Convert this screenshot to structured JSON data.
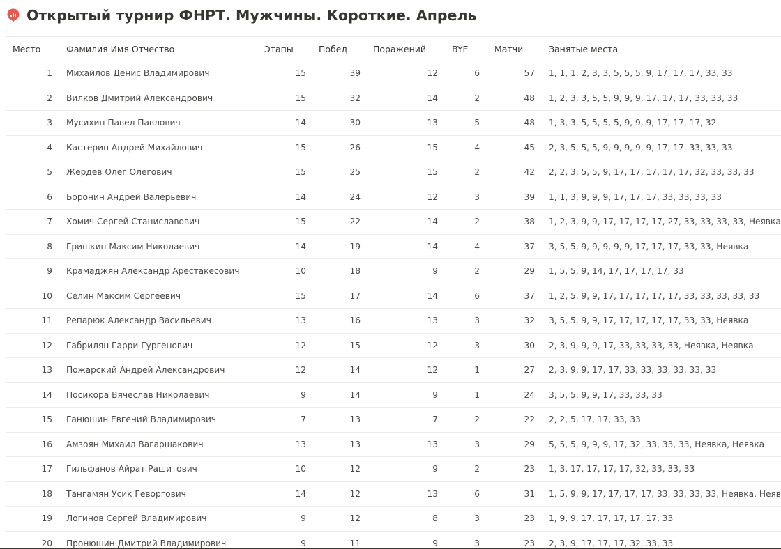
{
  "page": {
    "title": "Открытый турнир ФНРТ. Мужчины. Короткие. Апрель",
    "icon": "chart-pin-icon",
    "accent_color": "#e8584f"
  },
  "table": {
    "headers": {
      "place": "Место",
      "name": "Фамилия Имя Отчество",
      "stages": "Этапы",
      "wins": "Побед",
      "losses": "Поражений",
      "bye": "BYE",
      "matches": "Матчи",
      "places": "Занятые места"
    },
    "rows": [
      {
        "place": "1",
        "name": "Михайлов Денис Владимирович",
        "stages": "15",
        "wins": "39",
        "losses": "12",
        "bye": "6",
        "matches": "57",
        "places": "1, 1, 1, 2, 3, 3, 5, 5, 5, 9, 17, 17, 17, 33, 33"
      },
      {
        "place": "2",
        "name": "Вилков Дмитрий Александрович",
        "stages": "15",
        "wins": "32",
        "losses": "14",
        "bye": "2",
        "matches": "48",
        "places": "1, 2, 3, 3, 5, 5, 9, 9, 9, 17, 17, 17, 33, 33, 33"
      },
      {
        "place": "3",
        "name": "Мусихин Павел Павлович",
        "stages": "14",
        "wins": "30",
        "losses": "13",
        "bye": "5",
        "matches": "48",
        "places": "1, 3, 3, 5, 5, 5, 5, 9, 9, 9, 17, 17, 17, 32"
      },
      {
        "place": "4",
        "name": "Кастерин Андрей Михайлович",
        "stages": "15",
        "wins": "26",
        "losses": "15",
        "bye": "4",
        "matches": "45",
        "places": "2, 3, 5, 5, 5, 9, 9, 9, 9, 9, 17, 17, 33, 33, 33"
      },
      {
        "place": "5",
        "name": "Жердев Олег Олегович",
        "stages": "15",
        "wins": "25",
        "losses": "15",
        "bye": "2",
        "matches": "42",
        "places": "2, 2, 3, 5, 5, 9, 17, 17, 17, 17, 17, 32, 33, 33, 33"
      },
      {
        "place": "6",
        "name": "Боронин Андрей Валерьевич",
        "stages": "14",
        "wins": "24",
        "losses": "12",
        "bye": "3",
        "matches": "39",
        "places": "1, 1, 3, 9, 9, 9, 17, 17, 17, 33, 33, 33, 33"
      },
      {
        "place": "7",
        "name": "Хомич Сергей Станиславович",
        "stages": "15",
        "wins": "22",
        "losses": "14",
        "bye": "2",
        "matches": "38",
        "places": "1, 2, 3, 9, 9, 17, 17, 17, 17, 27, 33, 33, 33, 33, Неявка"
      },
      {
        "place": "8",
        "name": "Гришкин Максим Николаевич",
        "stages": "14",
        "wins": "19",
        "losses": "14",
        "bye": "4",
        "matches": "37",
        "places": "3, 5, 5, 9, 9, 9, 9, 9, 17, 17, 17, 33, 33, Неявка"
      },
      {
        "place": "9",
        "name": "Крамаджян Александр Арестакесович",
        "stages": "10",
        "wins": "18",
        "losses": "9",
        "bye": "2",
        "matches": "29",
        "places": "1, 5, 5, 9, 14, 17, 17, 17, 17, 33"
      },
      {
        "place": "10",
        "name": "Селин Максим Сергеевич",
        "stages": "15",
        "wins": "17",
        "losses": "14",
        "bye": "6",
        "matches": "37",
        "places": "1, 2, 5, 9, 9, 17, 17, 17, 17, 17, 33, 33, 33, 33, 33"
      },
      {
        "place": "11",
        "name": "Репарюк Александр Васильевич",
        "stages": "13",
        "wins": "16",
        "losses": "13",
        "bye": "3",
        "matches": "32",
        "places": "3, 5, 5, 9, 9, 17, 17, 17, 17, 17, 33, 33, Неявка"
      },
      {
        "place": "12",
        "name": "Габрилян Гарри Гургенович",
        "stages": "12",
        "wins": "15",
        "losses": "12",
        "bye": "3",
        "matches": "30",
        "places": "2, 3, 9, 9, 9, 17, 33, 33, 33, 33, Неявка, Неявка"
      },
      {
        "place": "13",
        "name": "Пожарский Андрей Александрович",
        "stages": "12",
        "wins": "14",
        "losses": "12",
        "bye": "1",
        "matches": "27",
        "places": "2, 3, 9, 9, 17, 17, 33, 33, 33, 33, 33, 33"
      },
      {
        "place": "14",
        "name": "Посикора Вячеслав Николаевич",
        "stages": "9",
        "wins": "14",
        "losses": "9",
        "bye": "1",
        "matches": "24",
        "places": "3, 5, 5, 9, 9, 17, 33, 33, 33"
      },
      {
        "place": "15",
        "name": "Ганюшин Евгений Владимирович",
        "stages": "7",
        "wins": "13",
        "losses": "7",
        "bye": "2",
        "matches": "22",
        "places": "2, 2, 5, 17, 17, 33, 33"
      },
      {
        "place": "16",
        "name": "Амзоян Михаил Вагаршакович",
        "stages": "13",
        "wins": "13",
        "losses": "13",
        "bye": "3",
        "matches": "29",
        "places": "5, 5, 5, 9, 9, 9, 17, 32, 33, 33, 33, Неявка, Неявка"
      },
      {
        "place": "17",
        "name": "Гильфанов Айрат Рашитович",
        "stages": "10",
        "wins": "12",
        "losses": "9",
        "bye": "2",
        "matches": "23",
        "places": "1, 3, 17, 17, 17, 17, 32, 33, 33, 33"
      },
      {
        "place": "18",
        "name": "Тангамян Усик Геворгович",
        "stages": "14",
        "wins": "12",
        "losses": "13",
        "bye": "6",
        "matches": "31",
        "places": "1, 5, 9, 9, 17, 17, 17, 17, 33, 33, 33, 33, Неявка, Неявка"
      },
      {
        "place": "19",
        "name": "Логинов Сергей Владимирович",
        "stages": "9",
        "wins": "12",
        "losses": "8",
        "bye": "3",
        "matches": "23",
        "places": "1, 9, 9, 17, 17, 17, 17, 17, 33"
      },
      {
        "place": "20",
        "name": "Пронюшин Дмитрий Владимирович",
        "stages": "9",
        "wins": "11",
        "losses": "9",
        "bye": "3",
        "matches": "23",
        "places": "2, 3, 9, 17, 17, 17, 32, 33, 33"
      }
    ]
  }
}
